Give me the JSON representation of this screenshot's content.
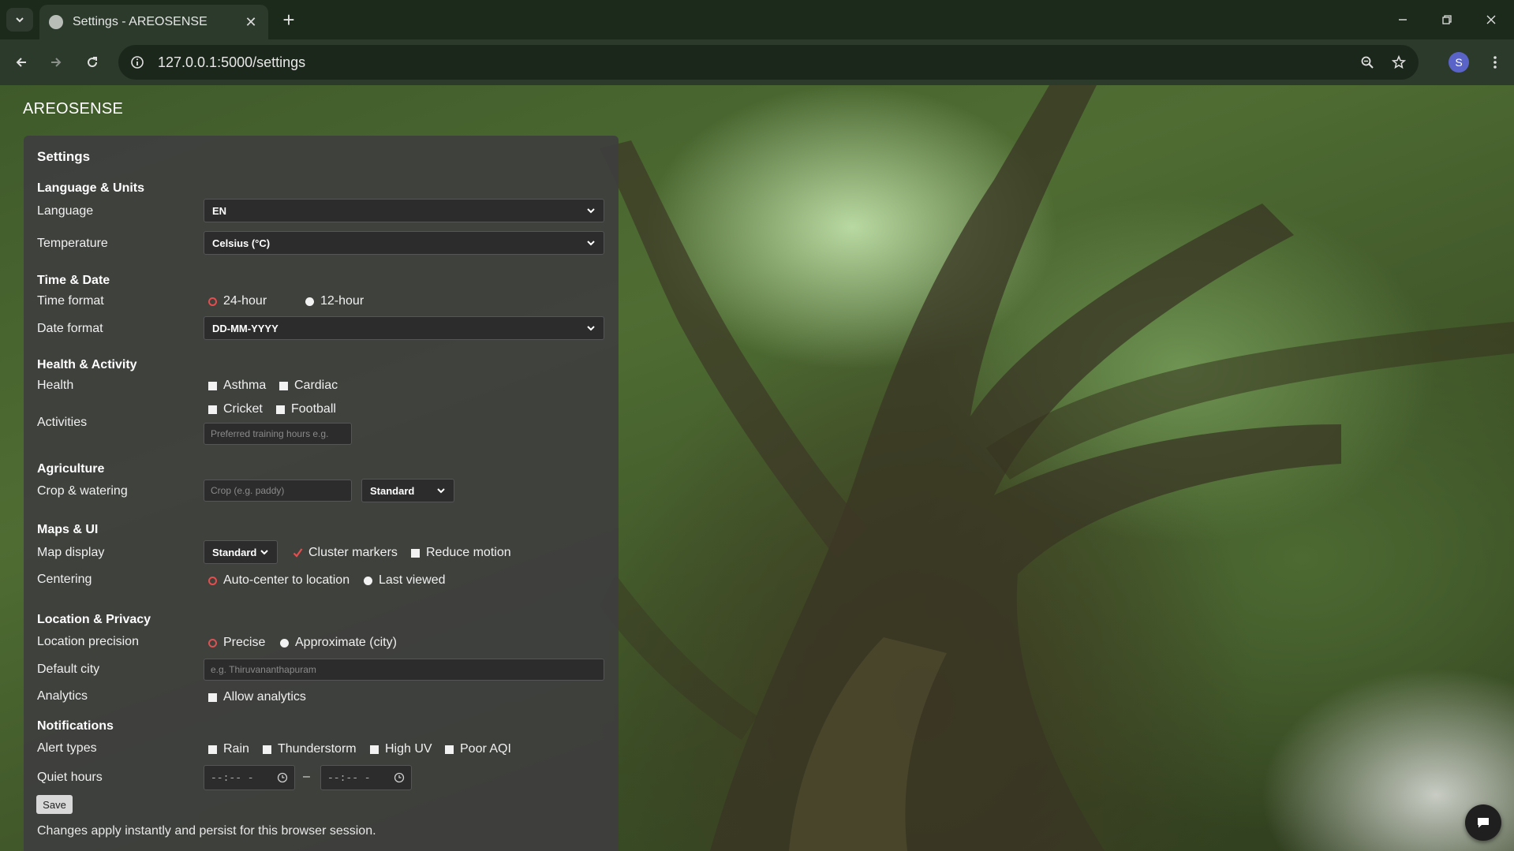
{
  "browser": {
    "tab_title": "Settings - AREOSENSE",
    "url": "127.0.0.1:5000/settings",
    "avatar_letter": "S",
    "new_tab_glyph": "+",
    "close_glyph": "✕"
  },
  "app": {
    "brand": "AREOSENSE"
  },
  "settings": {
    "title": "Settings",
    "language_units": {
      "heading": "Language & Units",
      "language_label": "Language",
      "language_value": "EN",
      "temperature_label": "Temperature",
      "temperature_value": "Celsius (°C)"
    },
    "time_date": {
      "heading": "Time & Date",
      "time_format_label": "Time format",
      "time_options": [
        "24-hour",
        "12-hour"
      ],
      "time_selected": "24-hour",
      "date_format_label": "Date format",
      "date_format_value": "DD-MM-YYYY"
    },
    "health_activity": {
      "heading": "Health & Activity",
      "health_label": "Health",
      "health_options": [
        "Asthma",
        "Cardiac"
      ],
      "activities_label": "Activities",
      "activity_options": [
        "Cricket",
        "Football"
      ],
      "training_placeholder": "Preferred training hours e.g."
    },
    "agriculture": {
      "heading": "Agriculture",
      "crop_label": "Crop & watering",
      "crop_placeholder": "Crop (e.g. paddy)",
      "watering_value": "Standard"
    },
    "maps_ui": {
      "heading": "Maps & UI",
      "map_display_label": "Map display",
      "map_style_value": "Standard",
      "cluster_label": "Cluster markers",
      "cluster_checked": true,
      "reduce_motion_label": "Reduce motion",
      "centering_label": "Centering",
      "centering_options": [
        "Auto-center to location",
        "Last viewed"
      ],
      "centering_selected": "Auto-center to location"
    },
    "location_privacy": {
      "heading": "Location & Privacy",
      "precision_label": "Location precision",
      "precision_options": [
        "Precise",
        "Approximate (city)"
      ],
      "precision_selected": "Precise",
      "default_city_label": "Default city",
      "default_city_placeholder": "e.g. Thiruvananthapuram",
      "analytics_label": "Analytics",
      "allow_analytics_label": "Allow analytics"
    },
    "notifications": {
      "heading": "Notifications",
      "alert_types_label": "Alert types",
      "alert_options": [
        "Rain",
        "Thunderstorm",
        "High UV",
        "Poor AQI"
      ],
      "quiet_hours_label": "Quiet hours",
      "quiet_start": "--:-- -",
      "quiet_end": "--:-- -",
      "range_separator": "–"
    },
    "save_label": "Save",
    "note": "Changes apply instantly and persist for this browser session."
  },
  "icons": {
    "tab_search": "chevron-down-icon",
    "favicon": "globe-icon",
    "back": "arrow-left-icon",
    "forward": "arrow-right-icon",
    "reload": "reload-icon",
    "site_info": "info-icon",
    "zoom": "zoom-icon",
    "bookmark": "star-icon",
    "menu": "kebab-menu-icon",
    "chat": "chat-icon"
  }
}
